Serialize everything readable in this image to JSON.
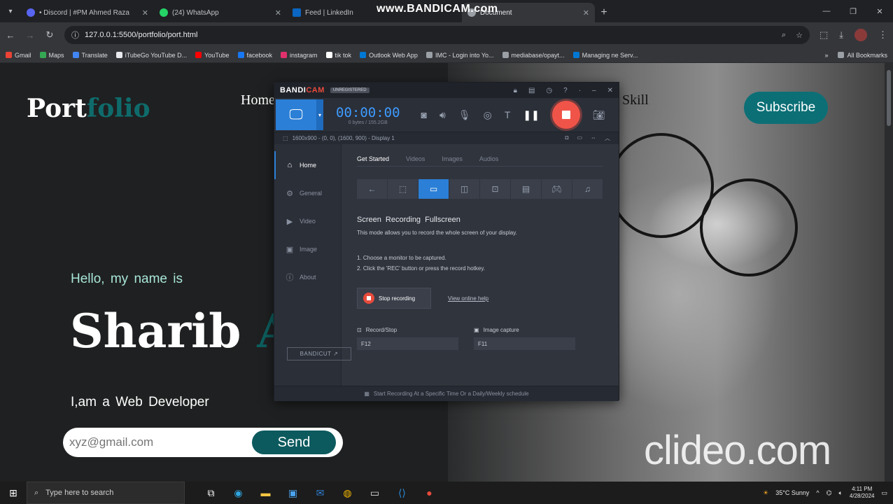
{
  "browser": {
    "tabs": [
      {
        "label": "• Discord | #PM Ahmed Raza",
        "color": "#5865f2"
      },
      {
        "label": "(24) WhatsApp",
        "color": "#25d366"
      },
      {
        "label": "Feed | LinkedIn",
        "color": "#0a66c2"
      },
      {
        "label": "Document",
        "color": "#9aa0a6",
        "active": true
      }
    ],
    "url": "127.0.0.1:5500/portfolio/port.html",
    "bookmarks": [
      {
        "label": "Gmail",
        "color": "#ea4335"
      },
      {
        "label": "Maps",
        "color": "#34a853"
      },
      {
        "label": "Translate",
        "color": "#4285f4"
      },
      {
        "label": "iTubeGo YouTube D...",
        "color": "#e8eaed"
      },
      {
        "label": "YouTube",
        "color": "#ff0000"
      },
      {
        "label": "facebook",
        "color": "#1877f2"
      },
      {
        "label": "instagram",
        "color": "#e1306c"
      },
      {
        "label": "tik tok",
        "color": "#ffffff"
      },
      {
        "label": "Outlook Web App",
        "color": "#0078d4"
      },
      {
        "label": "IMC - Login into Yo...",
        "color": "#9aa0a6"
      },
      {
        "label": "mediabase/opayt...",
        "color": "#9aa0a6"
      },
      {
        "label": "Managing ne Serv...",
        "color": "#0078d4"
      }
    ],
    "all_bookmarks": "All Bookmarks"
  },
  "watermark": {
    "bandicam": "www.BANDICAM.com"
  },
  "portfolio": {
    "logo_main": "Port",
    "logo_accent": "folio",
    "nav_home": "Home",
    "nav_skill": "Skill",
    "subscribe": "Subscribe",
    "hello": "Hello, my name is",
    "name_main": "Sharib ",
    "name_accent": "A",
    "role": "I,am a Web Developer",
    "email_placeholder": "xyz@gmail.com",
    "send": "Send"
  },
  "bandicam": {
    "logo_main": "BANDI",
    "logo_accent": "CAM",
    "badge": "UNREGISTERED",
    "timer": "00:00:00",
    "size": "0 bytes / 155.2GB",
    "info": "1600x900 - (0, 0), (1600, 900) - Display 1",
    "sidebar": [
      {
        "label": "Home",
        "icon": "⌂",
        "active": true
      },
      {
        "label": "General",
        "icon": "⚙"
      },
      {
        "label": "Video",
        "icon": "▶"
      },
      {
        "label": "Image",
        "icon": "▣"
      },
      {
        "label": "About",
        "icon": "ⓘ"
      }
    ],
    "bandicut": "BANDICUT ↗",
    "tabs": [
      "Get Started",
      "Videos",
      "Images",
      "Audios"
    ],
    "heading": "Screen Recording   Fullscreen",
    "description": "This mode allows you to record the whole screen of your display.",
    "step1": "1. Choose a monitor to be captured.",
    "step2": "2. Click the 'REC' button or press the record hotkey.",
    "stop_label": "Stop recording",
    "help_link": "View online help",
    "hotkey1_label": "Record/Stop",
    "hotkey1_value": "F12",
    "hotkey2_label": "Image capture",
    "hotkey2_value": "F11",
    "footer": "Start Recording At a Specific Time Or a Daily/Weekly schedule"
  },
  "clideo": "clideo.com",
  "taskbar": {
    "search_placeholder": "Type here to search",
    "weather": "35°C  Sunny",
    "time": "4:11 PM",
    "date": "4/28/2024"
  }
}
